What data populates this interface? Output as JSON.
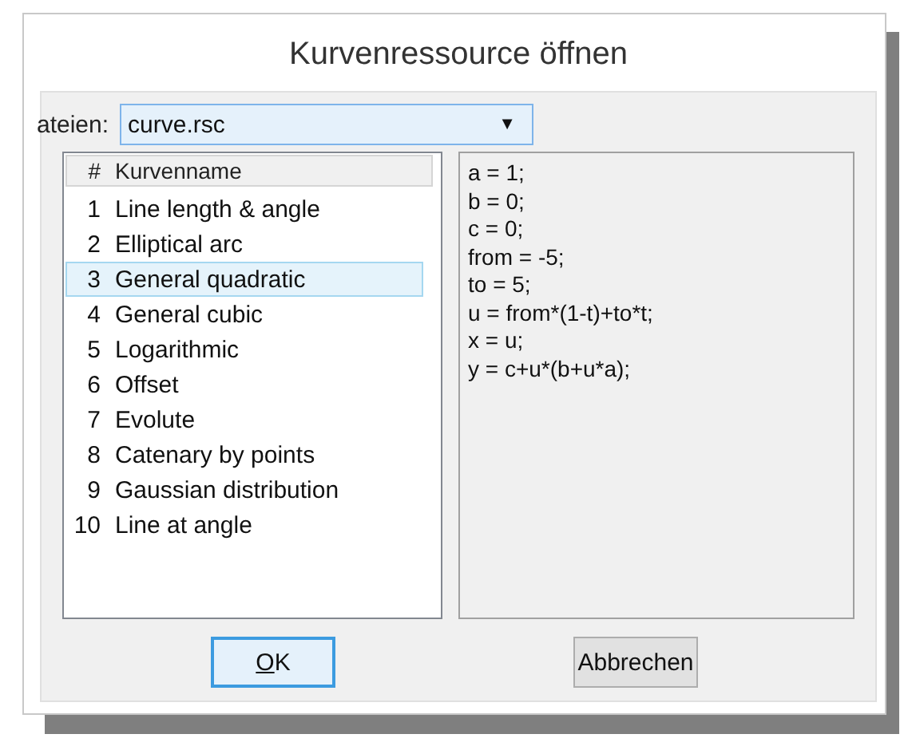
{
  "window": {
    "title": "Kurvenressource öffnen"
  },
  "file_field": {
    "label": "ateien:",
    "value": "curve.rsc",
    "arrow": "▼"
  },
  "curve_list": {
    "columns": [
      "#",
      "Kurvenname"
    ],
    "rows": [
      {
        "number": "1",
        "name": "Line length & angle",
        "selected": false
      },
      {
        "number": "2",
        "name": "Elliptical arc",
        "selected": false
      },
      {
        "number": "3",
        "name": "General quadratic",
        "selected": true
      },
      {
        "number": "4",
        "name": "General cubic",
        "selected": false
      },
      {
        "number": "5",
        "name": "Logarithmic",
        "selected": false
      },
      {
        "number": "6",
        "name": "Offset",
        "selected": false
      },
      {
        "number": "7",
        "name": "Evolute",
        "selected": false
      },
      {
        "number": "8",
        "name": "Catenary by points",
        "selected": false
      },
      {
        "number": "9",
        "name": "Gaussian distribution",
        "selected": false
      },
      {
        "number": "10",
        "name": "Line at angle",
        "selected": false
      }
    ]
  },
  "code_lines": [
    "a = 1;",
    "b = 0;",
    "c = 0;",
    "from = -5;",
    "to = 5;",
    "u = from*(1-t)+to*t;",
    "x = u;",
    "y = c+u*(b+u*a);"
  ],
  "buttons": [
    {
      "label": "OK",
      "kind": "default"
    },
    {
      "label": "Abbrechen",
      "kind": "normal"
    }
  ]
}
